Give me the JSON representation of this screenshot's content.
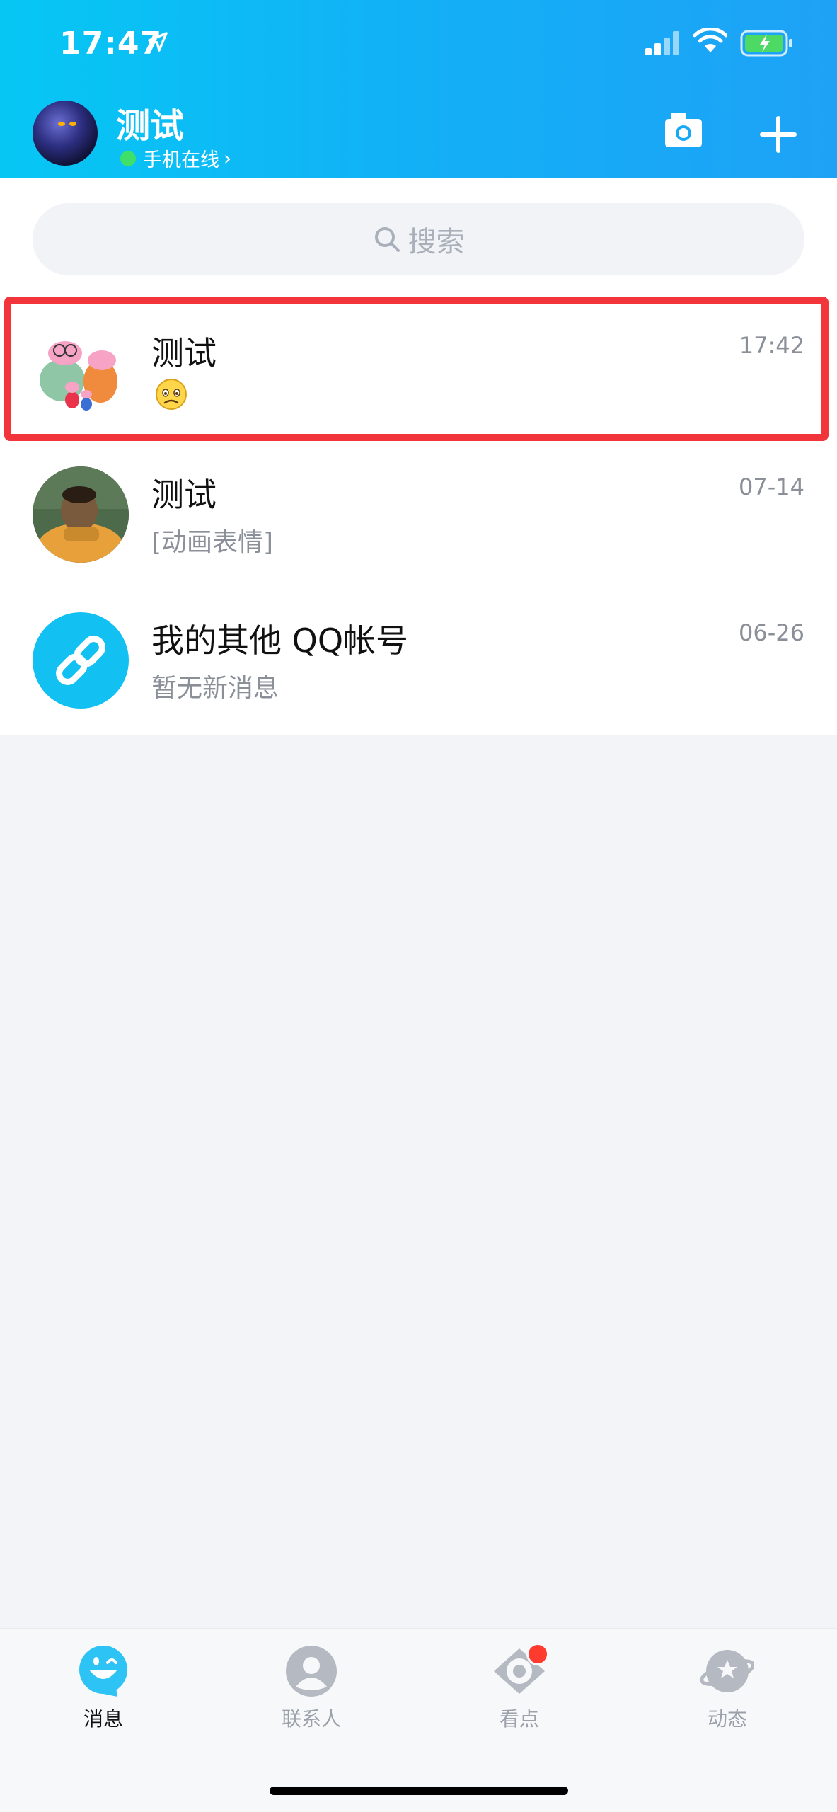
{
  "status_bar": {
    "time": "17:47"
  },
  "header": {
    "profile_name": "测试",
    "online_status": "手机在线",
    "status_chevron": "›",
    "camera_icon": "camera-icon",
    "add_icon": "plus-icon"
  },
  "search": {
    "placeholder": "搜索"
  },
  "messages": [
    {
      "name": "测试",
      "preview_type": "emoji",
      "time": "17:42",
      "highlighted": true
    },
    {
      "name": "测试",
      "preview": "[动画表情]",
      "time": "07-14",
      "highlighted": false
    },
    {
      "name": "我的其他 QQ帐号",
      "preview": "暂无新消息",
      "time": "06-26",
      "highlighted": false
    }
  ],
  "tabbar": {
    "items": [
      {
        "label": "消息",
        "active": true,
        "icon": "message-face-icon"
      },
      {
        "label": "联系人",
        "active": false,
        "icon": "contact-icon"
      },
      {
        "label": "看点",
        "active": false,
        "icon": "eye-icon",
        "badge": true
      },
      {
        "label": "动态",
        "active": false,
        "icon": "planet-star-icon"
      }
    ]
  },
  "colors": {
    "header_gradient_start": "#06c7f4",
    "header_gradient_end": "#1ea2f6",
    "highlight_border": "#f2353b",
    "link_avatar": "#12c0f2",
    "badge": "#ff3b30"
  }
}
